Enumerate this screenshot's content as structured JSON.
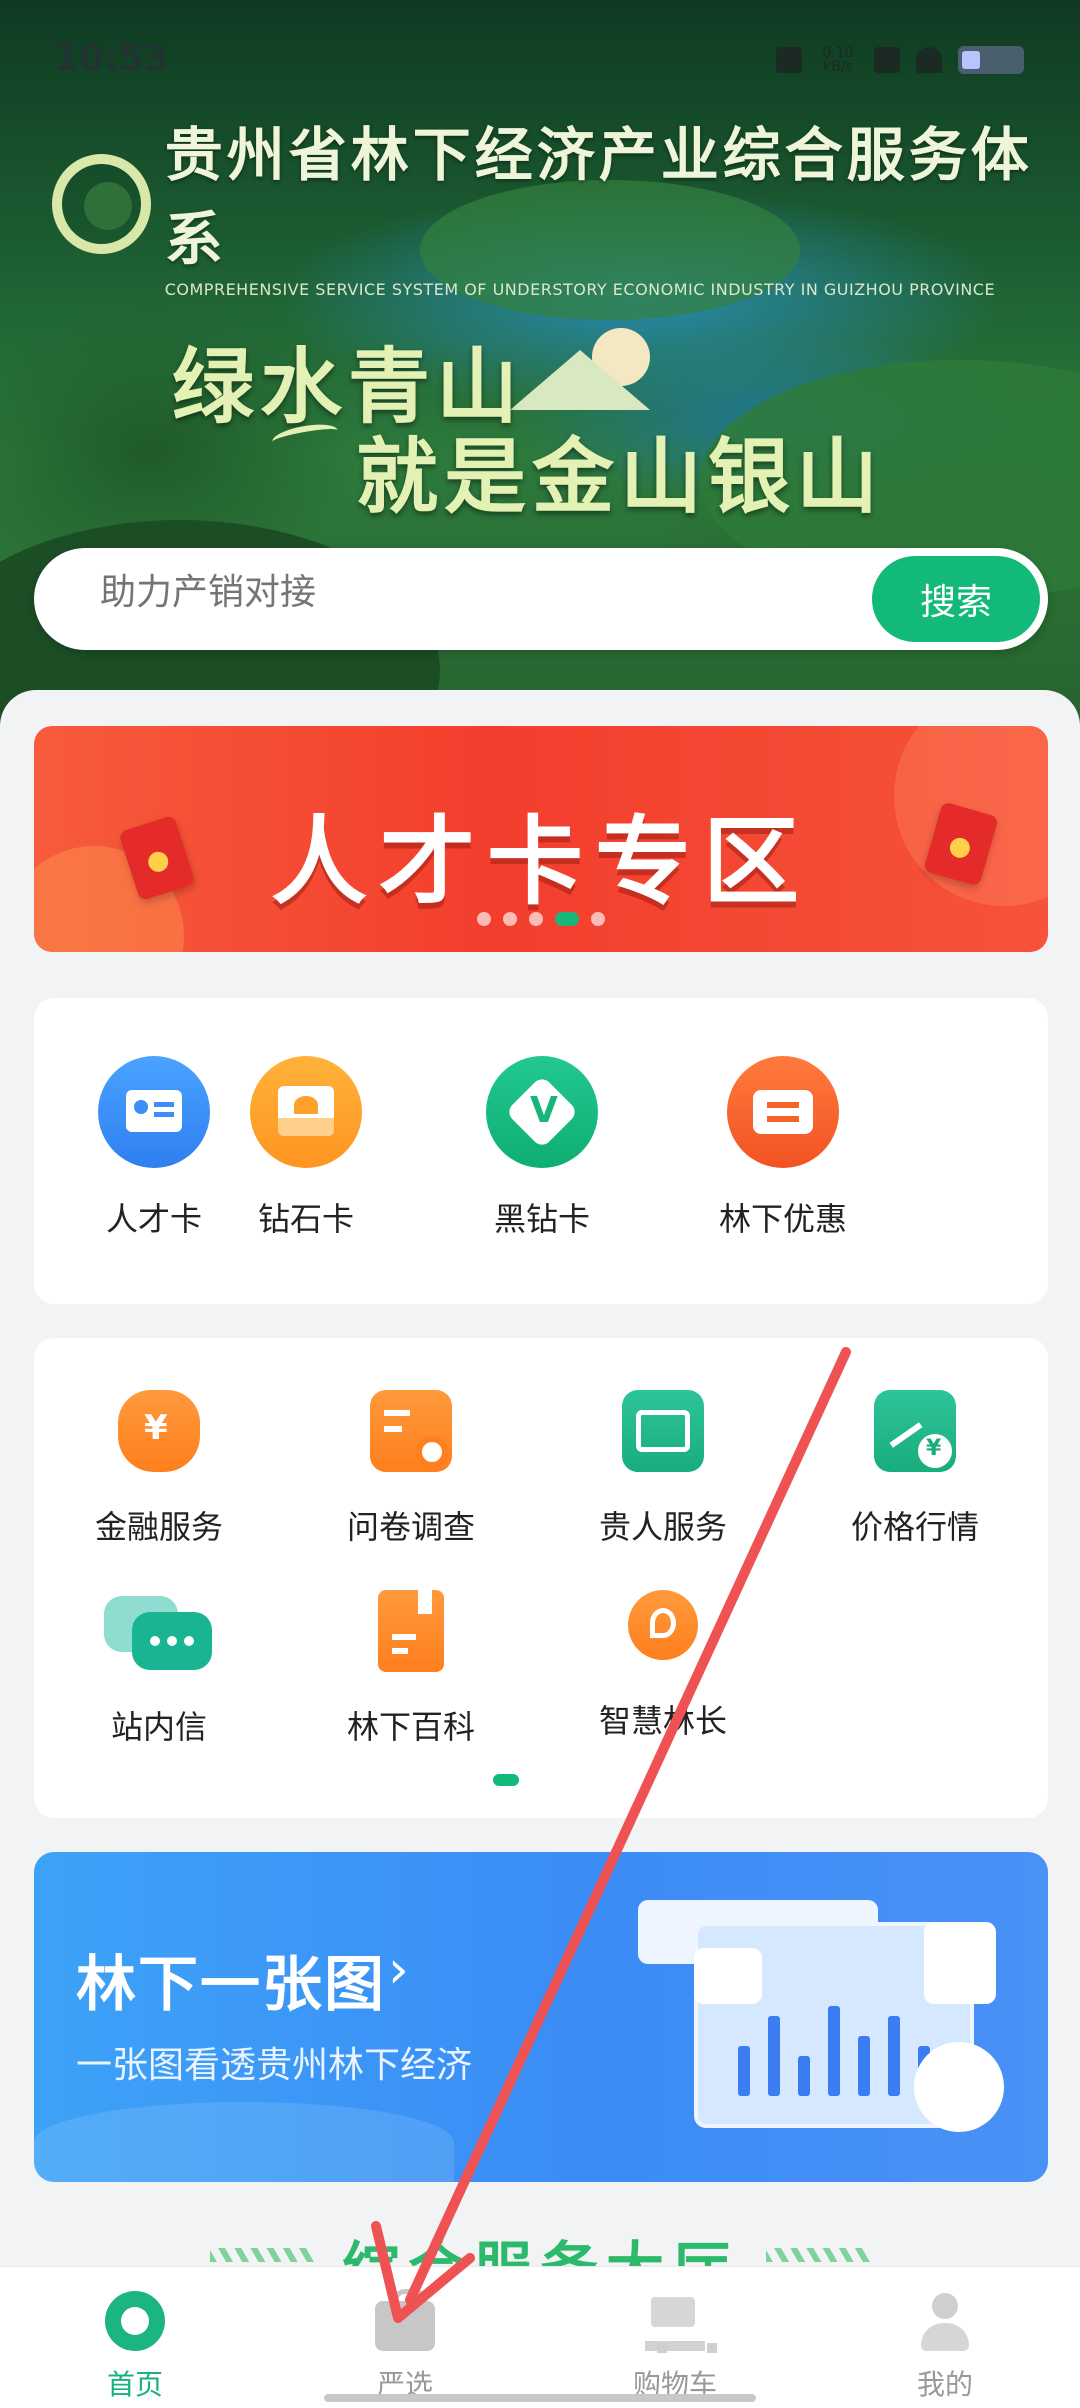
{
  "status_bar": {
    "time": "10:53",
    "net_speed": "0.10 kB/s"
  },
  "header": {
    "title": "贵州省林下经济产业综合服务体系",
    "subtitle": "COMPREHENSIVE SERVICE SYSTEM OF UNDERSTORY ECONOMIC INDUSTRY IN GUIZHOU PROVINCE",
    "slogan_line1": "绿水青山",
    "slogan_line2": "就是金山银山"
  },
  "search": {
    "placeholder": "助力产销对接",
    "button_label": "搜索"
  },
  "banner": {
    "title": "人才卡专区",
    "slides": 5,
    "active_slide": 4
  },
  "cards_row": [
    {
      "label": "人才卡",
      "icon": "id-card-icon",
      "color": "#3a8ef6"
    },
    {
      "label": "钻石卡",
      "icon": "envelope-heart-icon",
      "color": "#ffa02c"
    },
    {
      "label": "黑钻卡",
      "icon": "v-badge-icon",
      "color": "#17b67a"
    },
    {
      "label": "林下优惠",
      "icon": "ticket-icon",
      "color": "#f5622a"
    }
  ],
  "services": [
    {
      "label": "金融服务",
      "icon": "money-bag-icon"
    },
    {
      "label": "问卷调查",
      "icon": "survey-icon"
    },
    {
      "label": "贵人服务",
      "icon": "service-seal-icon"
    },
    {
      "label": "价格行情",
      "icon": "price-trend-icon"
    },
    {
      "label": "站内信",
      "icon": "chat-bubbles-icon"
    },
    {
      "label": "林下百科",
      "icon": "encyclopedia-icon"
    },
    {
      "label": "智慧林长",
      "icon": "leaf-hexagon-icon"
    }
  ],
  "map_card": {
    "title": "林下一张图",
    "chevron": "›",
    "subtitle": "一张图看透贵州林下经济"
  },
  "section_heading": "综合服务大厅",
  "bottom_nav": [
    {
      "label": "首页",
      "icon": "home-logo-icon",
      "active": true
    },
    {
      "label": "严选",
      "icon": "shopping-bag-icon",
      "active": false
    },
    {
      "label": "购物车",
      "icon": "cart-icon",
      "active": false
    },
    {
      "label": "我的",
      "icon": "user-icon",
      "active": false
    }
  ]
}
